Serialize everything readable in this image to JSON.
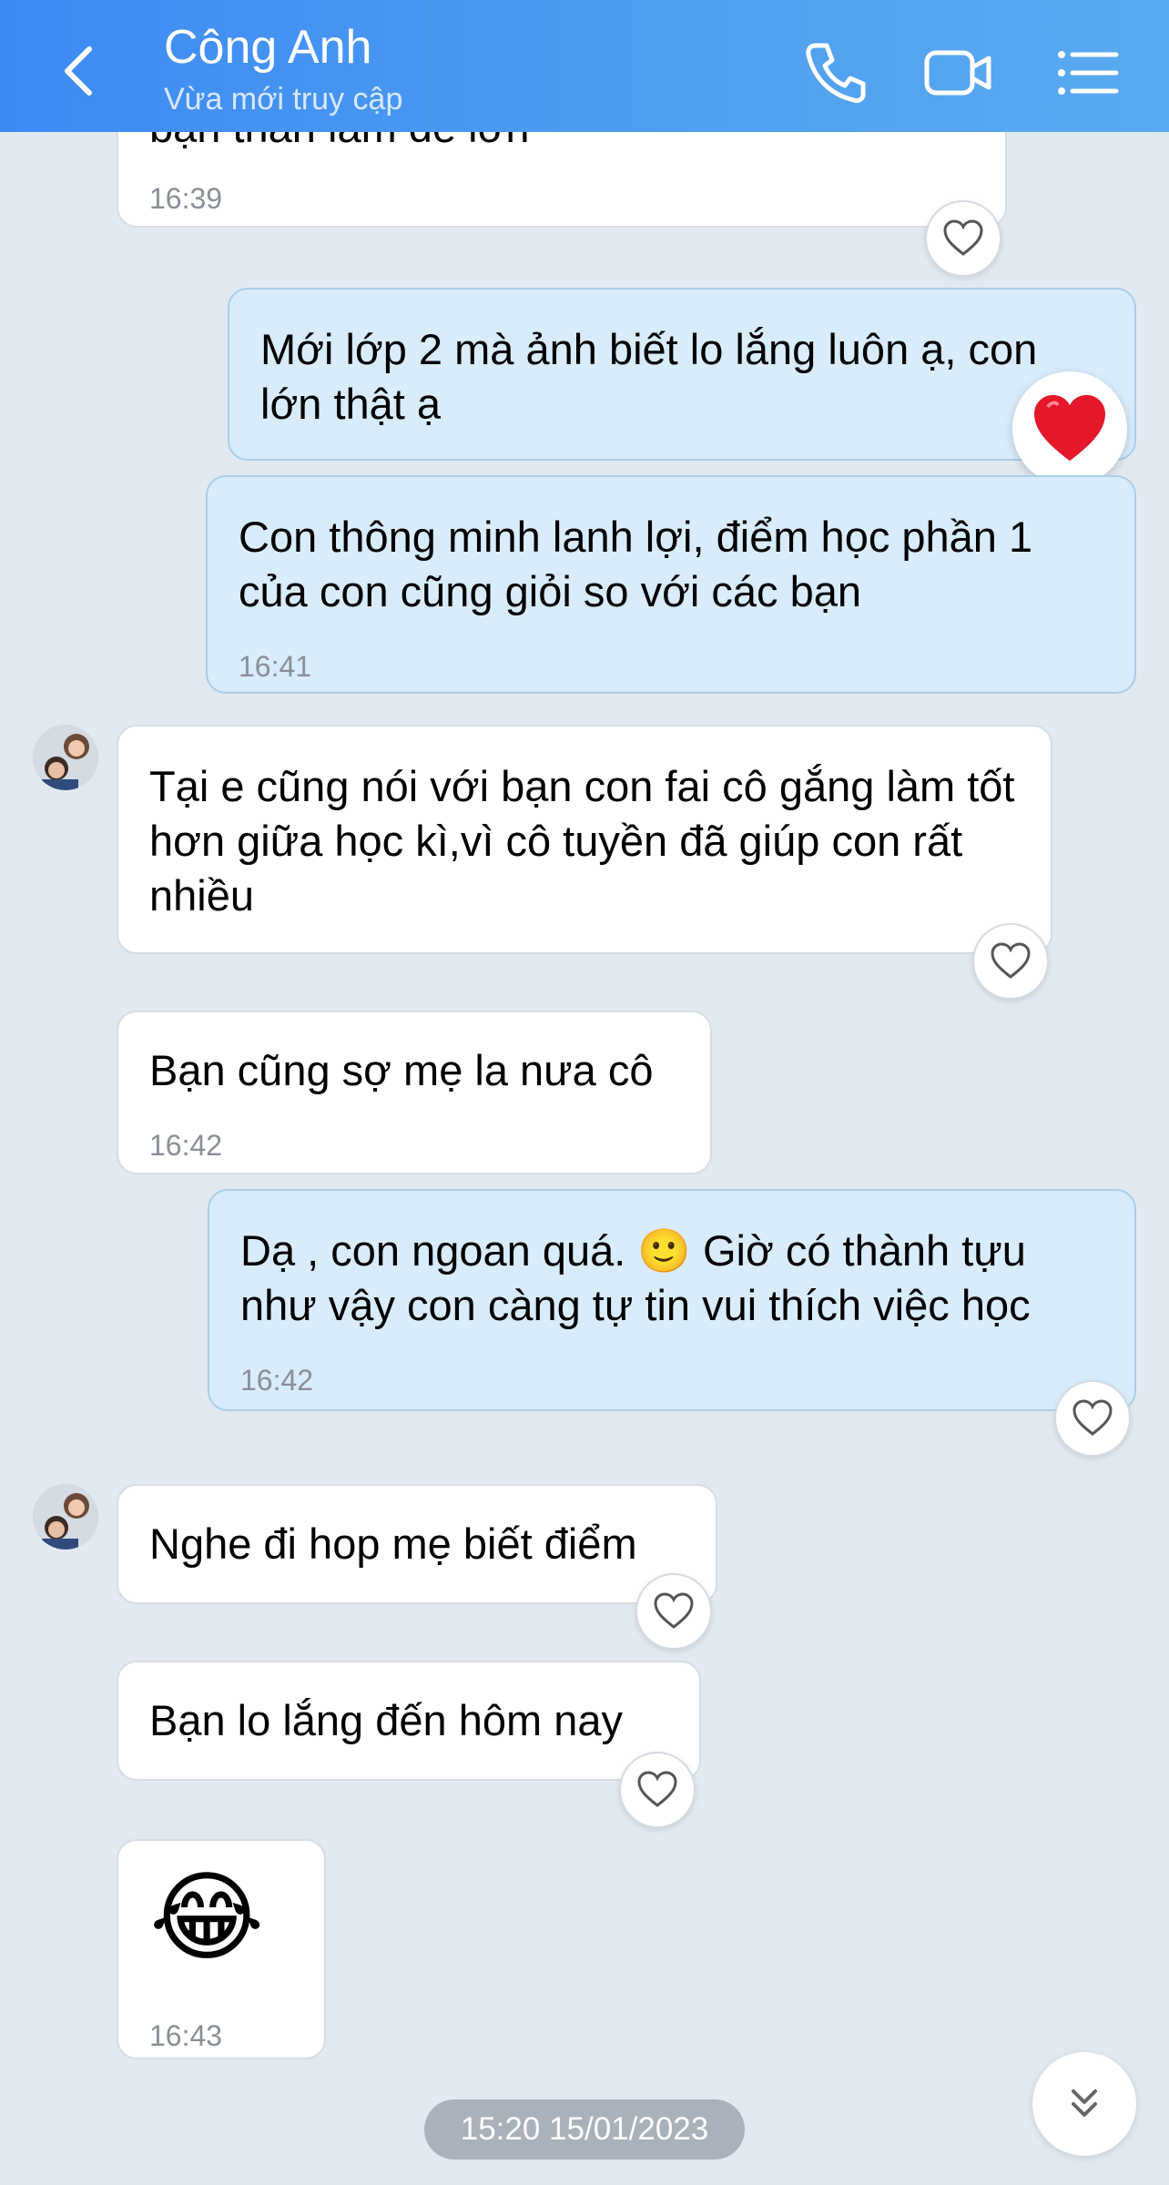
{
  "header": {
    "contact_name": "Công Anh",
    "status": "Vừa mới truy cập",
    "accent": "#3d8af3"
  },
  "messages": [
    {
      "side": "in",
      "text": "bạn thân làm đề lớn",
      "time": "16:39"
    },
    {
      "side": "out",
      "text": "Mới lớp 2 mà ảnh biết lo lắng luôn ạ, con lớn thật ạ",
      "reaction": "heart-red"
    },
    {
      "side": "out",
      "text": "Con thông minh lanh lợi, điểm học phần 1 của con cũng giỏi so với các bạn",
      "time": "16:41"
    },
    {
      "side": "in",
      "text": "Tại e cũng nói với bạn con fai cô gắng làm tốt hơn giữa học kì,vì cô tuyền đã giúp con rất nhiều"
    },
    {
      "side": "in",
      "text": "Bạn cũng sợ mẹ la nưa cô",
      "time": "16:42"
    },
    {
      "side": "out",
      "text": "Dạ , con ngoan quá. 🙂 Giờ có thành tựu như vậy con càng tự tin vui thích việc học",
      "time": "16:42"
    },
    {
      "side": "in",
      "text": "Nghe đi hop mẹ biết điểm"
    },
    {
      "side": "in",
      "text": "Bạn lo lắng đến hôm nay"
    },
    {
      "side": "in",
      "text": "😂",
      "time": "16:43"
    }
  ],
  "date_separator": "15:20 15/01/2023",
  "icons": {
    "back": "chevron-left-icon",
    "call": "phone-icon",
    "video": "video-camera-icon",
    "menu": "list-icon",
    "react": "heart-outline-icon",
    "scroll": "double-chevron-down-icon"
  }
}
